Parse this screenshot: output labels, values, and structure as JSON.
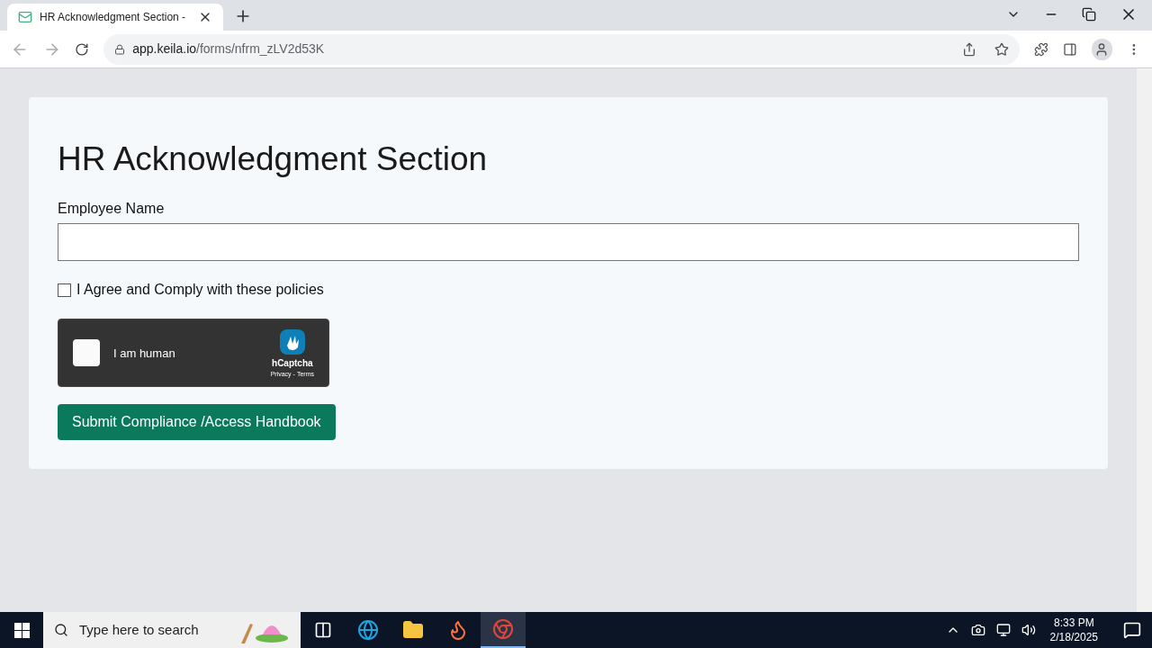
{
  "browser": {
    "tab": {
      "title": "HR Acknowledgment Section -",
      "selected": true
    },
    "url": {
      "host": "app.keila.io",
      "path": "/forms/nfrm_zLV2d53K"
    }
  },
  "form": {
    "title": "HR Acknowledgment Section",
    "name_field": {
      "label": "Employee Name"
    },
    "agree": {
      "label": "I Agree and Comply with these policies",
      "checked": false
    },
    "captcha": {
      "label": "I am human",
      "checked": false,
      "brand": "hCaptcha",
      "links": [
        "Privacy",
        "Terms"
      ],
      "links_separator": "-"
    },
    "submit": "Submit Compliance /Access Handbook"
  },
  "taskbar": {
    "search_placeholder": "Type here to search",
    "apps": [
      {
        "kind": "taskview",
        "selected": false
      },
      {
        "kind": "edge",
        "selected": false
      },
      {
        "kind": "files",
        "selected": false
      },
      {
        "kind": "firefox",
        "selected": false
      },
      {
        "kind": "chrome",
        "selected": true
      }
    ],
    "time": "8:33 PM",
    "date": "2/18/2025"
  }
}
